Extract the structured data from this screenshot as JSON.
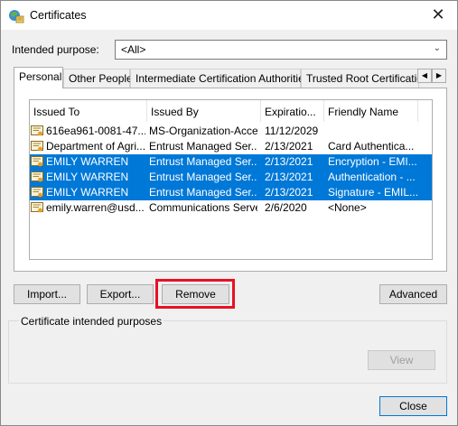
{
  "window": {
    "title": "Certificates",
    "icon": "certificates-app-icon"
  },
  "purpose": {
    "label": "Intended purpose:",
    "value": "<All>"
  },
  "tabs": [
    {
      "label": "Personal",
      "active": true
    },
    {
      "label": "Other People",
      "active": false
    },
    {
      "label": "Intermediate Certification Authorities",
      "active": false
    },
    {
      "label": "Trusted Root Certification",
      "active": false
    }
  ],
  "table": {
    "columns": [
      "Issued To",
      "Issued By",
      "Expiratio...",
      "Friendly Name"
    ],
    "rows": [
      {
        "issued_to": "616ea961-0081-47...",
        "issued_by": "MS-Organization-Access",
        "expiration": "11/12/2029",
        "friendly": "",
        "selected": false
      },
      {
        "issued_to": "Department of Agri...",
        "issued_by": "Entrust Managed Ser...",
        "expiration": "2/13/2021",
        "friendly": "Card Authentica...",
        "selected": false
      },
      {
        "issued_to": "EMILY WARREN",
        "issued_by": "Entrust Managed Ser...",
        "expiration": "2/13/2021",
        "friendly": "Encryption - EMI...",
        "selected": true
      },
      {
        "issued_to": "EMILY WARREN",
        "issued_by": "Entrust Managed Ser...",
        "expiration": "2/13/2021",
        "friendly": "Authentication - ...",
        "selected": true
      },
      {
        "issued_to": "EMILY WARREN",
        "issued_by": "Entrust Managed Ser...",
        "expiration": "2/13/2021",
        "friendly": "Signature - EMIL...",
        "selected": true
      },
      {
        "issued_to": "emily.warren@usd...",
        "issued_by": "Communications Server",
        "expiration": "2/6/2020",
        "friendly": "<None>",
        "selected": false
      }
    ]
  },
  "buttons": {
    "import": "Import...",
    "export": "Export...",
    "remove": "Remove",
    "advanced": "Advanced",
    "view": "View",
    "close": "Close"
  },
  "purposes_group": {
    "label": "Certificate intended purposes"
  },
  "colors": {
    "selection": "#0078d7",
    "highlight_box": "#e81123"
  }
}
